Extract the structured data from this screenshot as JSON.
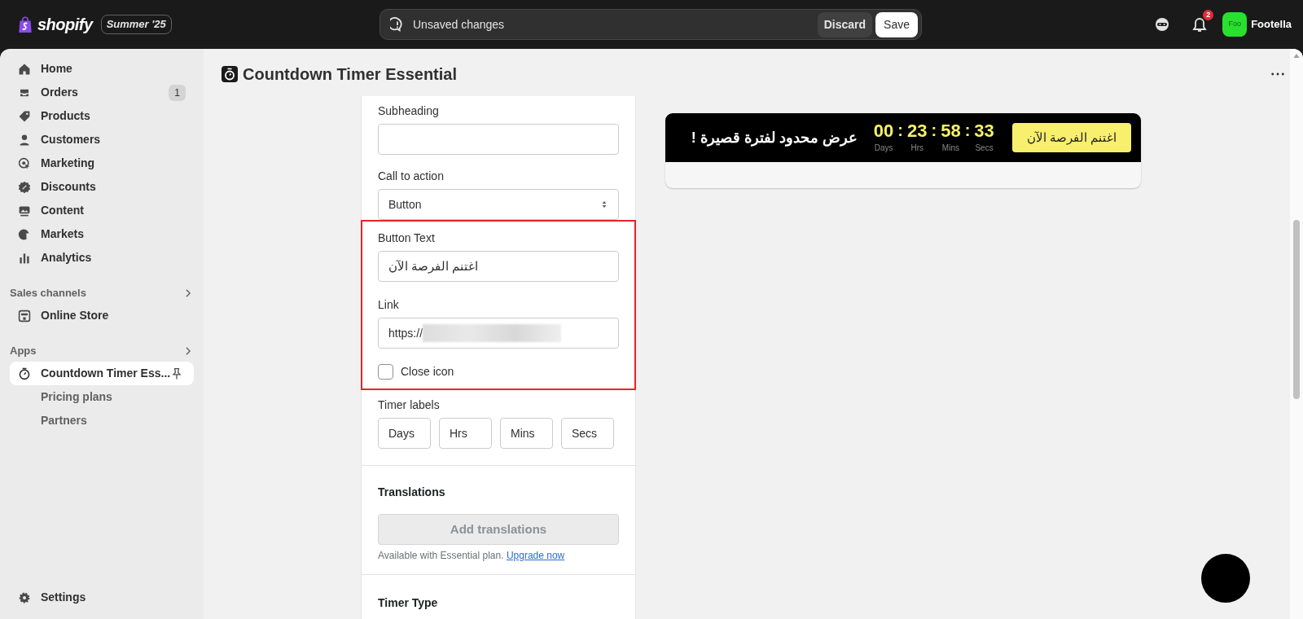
{
  "topbar": {
    "logo": "shopify",
    "edition_badge": "Summer '25",
    "save_bar": {
      "message": "Unsaved changes",
      "discard": "Discard",
      "save": "Save"
    },
    "notification_count": "2",
    "store": {
      "avatar": "Foo",
      "name": "Footella"
    }
  },
  "sidebar": {
    "items": [
      {
        "label": "Home",
        "selected": false
      },
      {
        "label": "Orders",
        "count": "1",
        "selected": false
      },
      {
        "label": "Products",
        "selected": false
      },
      {
        "label": "Customers",
        "selected": false
      },
      {
        "label": "Marketing",
        "selected": false
      },
      {
        "label": "Discounts",
        "selected": false
      },
      {
        "label": "Content",
        "selected": false
      },
      {
        "label": "Markets",
        "selected": false
      },
      {
        "label": "Analytics",
        "selected": false
      }
    ],
    "sections": [
      {
        "title": "Sales channels",
        "items": [
          {
            "label": "Online Store",
            "selected": false
          }
        ]
      },
      {
        "title": "Apps",
        "items": [
          {
            "label": "Countdown Timer Ess...",
            "selected": true,
            "pinned": true,
            "children": [
              {
                "label": "Pricing plans"
              },
              {
                "label": "Partners"
              }
            ]
          }
        ]
      }
    ],
    "settings": "Settings"
  },
  "page": {
    "title": "Countdown Timer Essential"
  },
  "form": {
    "fields": [
      {
        "kind": "text",
        "label": "Subheading"
      },
      {
        "kind": "select",
        "label": "Call to action",
        "value": "Button"
      },
      {
        "kind": "text",
        "label": "Button Text",
        "value": "اغتنم الفرصة الآن",
        "highlighted": true
      },
      {
        "kind": "link",
        "label": "Link",
        "value": "https://",
        "highlighted": true
      },
      {
        "kind": "checkbox",
        "label": "Close icon",
        "checked": false,
        "highlighted": true
      }
    ],
    "timer_labels": {
      "label": "Timer labels",
      "values": [
        "Days",
        "Hrs",
        "Mins",
        "Secs"
      ]
    },
    "translations": {
      "title": "Translations",
      "button": "Add translations",
      "note": "Available with Essential plan.",
      "link": "Upgrade now"
    },
    "next_section": "Timer Type"
  },
  "preview": {
    "headline": "عرض محدود لفترة قصيرة !",
    "units": [
      {
        "value": "00",
        "label": "Days"
      },
      {
        "value": "23",
        "label": "Hrs"
      },
      {
        "value": "58",
        "label": "Mins"
      },
      {
        "value": "33",
        "label": "Secs"
      }
    ],
    "separator": ":",
    "cta": "اغتنم الفرصة الآن"
  }
}
